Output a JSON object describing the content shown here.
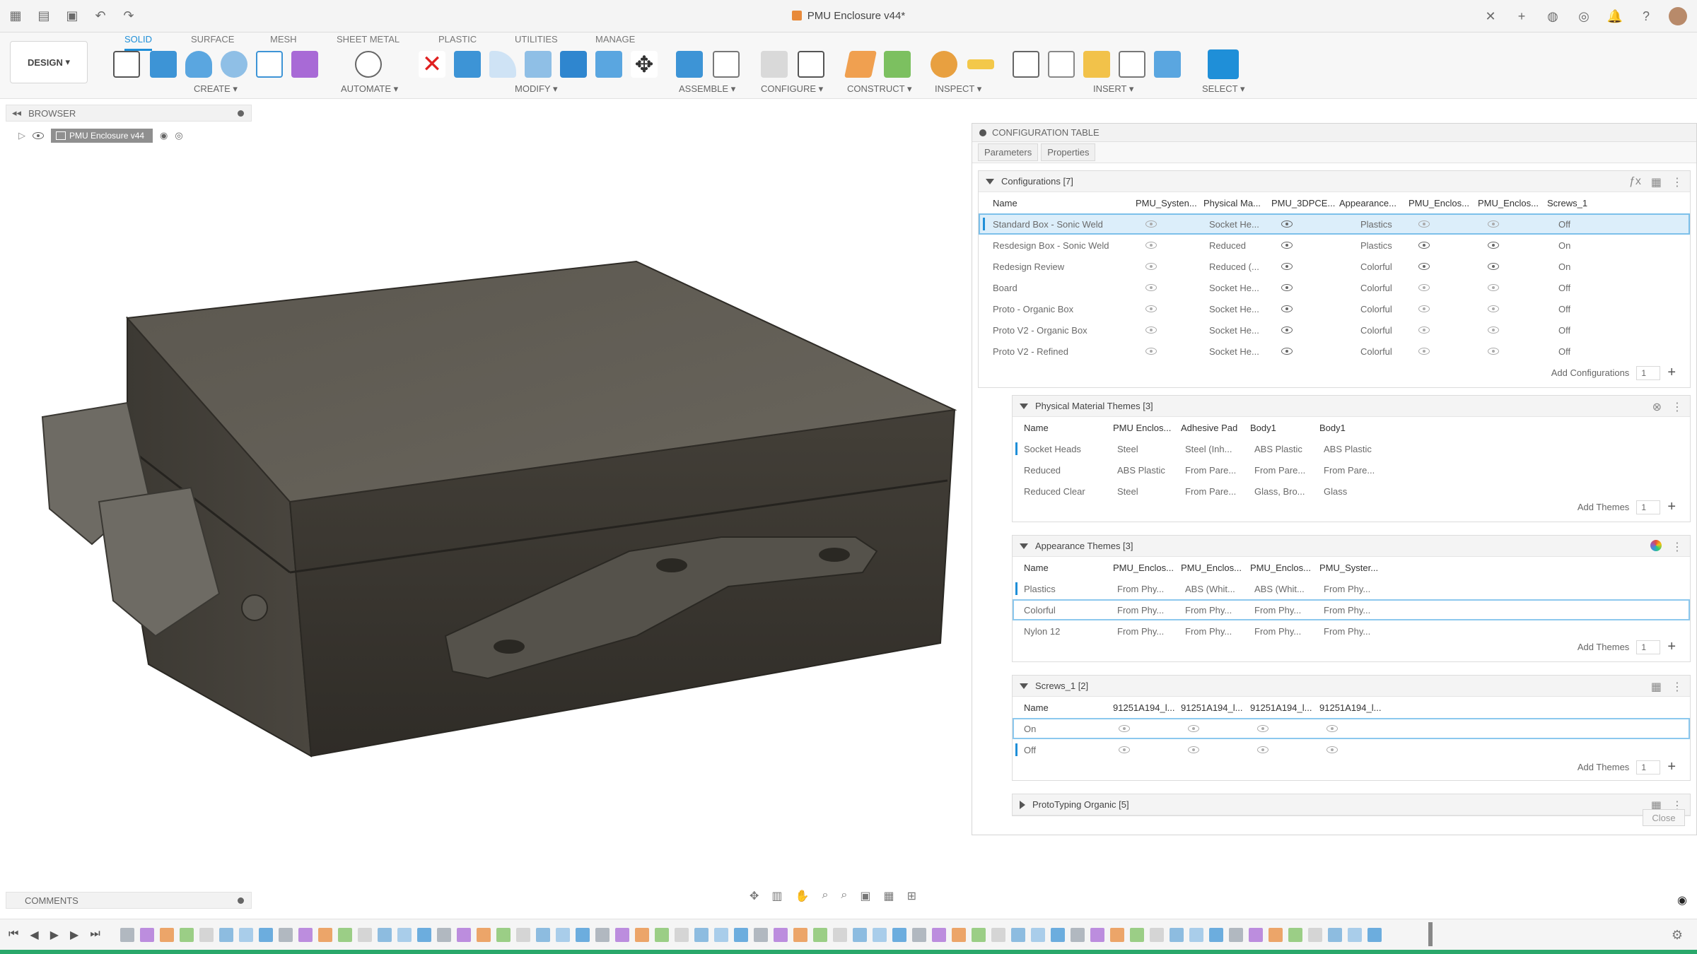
{
  "window": {
    "title": "PMU Enclosure v44*"
  },
  "toolbar": {
    "design_label": "DESIGN",
    "tabs": [
      "SOLID",
      "SURFACE",
      "MESH",
      "SHEET METAL",
      "PLASTIC",
      "UTILITIES",
      "MANAGE"
    ],
    "groups": [
      "CREATE",
      "AUTOMATE",
      "MODIFY",
      "ASSEMBLE",
      "CONFIGURE",
      "CONSTRUCT",
      "INSPECT",
      "INSERT",
      "SELECT"
    ],
    "accent": "#1f8fd8"
  },
  "browser": {
    "label": "BROWSER",
    "root_item": "PMU Enclosure v44"
  },
  "comments": {
    "label": "COMMENTS"
  },
  "config_table": {
    "title": "CONFIGURATION TABLE",
    "tabs": [
      "Parameters",
      "Properties"
    ],
    "configurations": {
      "title": "Configurations [7]",
      "columns": [
        "Name",
        "PMU_Systen...",
        "Physical Ma...",
        "PMU_3DPCE...",
        "Appearance...",
        "PMU_Enclos...",
        "PMU_Enclos...",
        "Screws_1"
      ],
      "rows": [
        {
          "name": "Standard Box - Sonic Weld",
          "c1": "",
          "c2": "Socket He...",
          "c3": "",
          "c4": "Plastics",
          "c5": "",
          "c6": "",
          "c7": "Off"
        },
        {
          "name": "Resdesign Box - Sonic Weld",
          "c1": "",
          "c2": "Reduced",
          "c3": "",
          "c4": "Plastics",
          "c5": "",
          "c6": "",
          "c7": "On"
        },
        {
          "name": "Redesign Review",
          "c1": "",
          "c2": "Reduced (...",
          "c3": "",
          "c4": "Colorful",
          "c5": "",
          "c6": "",
          "c7": "On"
        },
        {
          "name": "Board",
          "c1": "",
          "c2": "Socket He...",
          "c3": "",
          "c4": "Colorful",
          "c5": "",
          "c6": "",
          "c7": "Off"
        },
        {
          "name": "Proto - Organic Box",
          "c1": "",
          "c2": "Socket He...",
          "c3": "",
          "c4": "Colorful",
          "c5": "",
          "c6": "",
          "c7": "Off"
        },
        {
          "name": "Proto V2 - Organic Box",
          "c1": "",
          "c2": "Socket He...",
          "c3": "",
          "c4": "Colorful",
          "c5": "",
          "c6": "",
          "c7": "Off"
        },
        {
          "name": "Proto V2 - Refined",
          "c1": "",
          "c2": "Socket He...",
          "c3": "",
          "c4": "Colorful",
          "c5": "",
          "c6": "",
          "c7": "Off"
        }
      ],
      "add_label": "Add Configurations",
      "add_count": "1"
    },
    "physical": {
      "title": "Physical Material Themes [3]",
      "columns": [
        "Name",
        "PMU Enclos...",
        "Adhesive Pad",
        "Body1",
        "Body1"
      ],
      "rows": [
        [
          "Socket Heads",
          "Steel",
          "Steel (Inh...",
          "ABS Plastic",
          "ABS Plastic"
        ],
        [
          "Reduced",
          "ABS Plastic",
          "From Pare...",
          "From Pare...",
          "From Pare..."
        ],
        [
          "Reduced Clear",
          "Steel",
          "From Pare...",
          "Glass, Bro...",
          "Glass"
        ]
      ],
      "add_label": "Add Themes",
      "add_count": "1"
    },
    "appearance": {
      "title": "Appearance Themes [3]",
      "columns": [
        "Name",
        "PMU_Enclos...",
        "PMU_Enclos...",
        "PMU_Enclos...",
        "PMU_Syster..."
      ],
      "rows": [
        [
          "Plastics",
          "From Phy...",
          "ABS (Whit...",
          "ABS (Whit...",
          "From Phy..."
        ],
        [
          "Colorful",
          "From Phy...",
          "From Phy...",
          "From Phy...",
          "From Phy..."
        ],
        [
          "Nylon 12",
          "From Phy...",
          "From Phy...",
          "From Phy...",
          "From Phy..."
        ]
      ],
      "add_label": "Add Themes",
      "add_count": "1"
    },
    "screws": {
      "title": "Screws_1 [2]",
      "columns": [
        "Name",
        "91251A194_l...",
        "91251A194_l...",
        "91251A194_l...",
        "91251A194_l..."
      ],
      "rows": [
        "On",
        "Off"
      ],
      "add_label": "Add Themes",
      "add_count": "1"
    },
    "proto": {
      "title": "ProtoTyping Organic [5]"
    },
    "close_label": "Close"
  }
}
